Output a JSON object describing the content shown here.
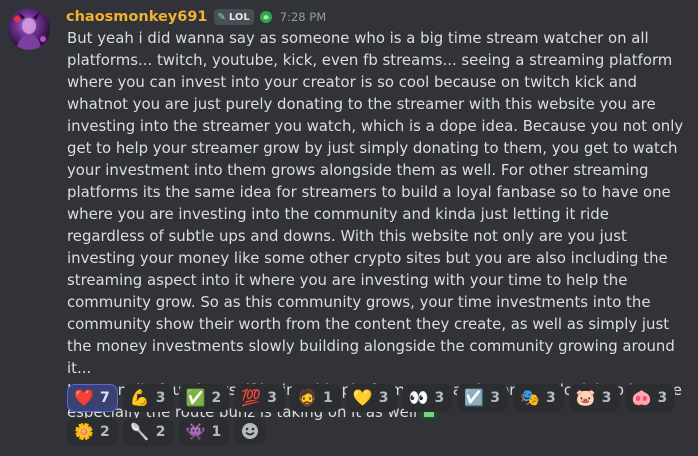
{
  "message": {
    "username": "chaosmonkey691",
    "tag": "LOL",
    "timestamp": "7:28 PM",
    "paragraphs": [
      "But yeah i did wanna say as someone who is a big time stream watcher on all platforms... twitch, youtube, kick, even fb streams... seeing a streaming platform where you can invest into your creator is so cool because on twitch kick and whatnot you are just purely donating to the streamer with this website you are investing into the streamer you watch, which is a dope idea. Because you not only get to help your streamer grow by just simply donating to them, you get to watch your investment into them grows alongside them as well. For other streaming platforms its the same idea for streamers to build a loyal fanbase so to have one where you are investing into the community and kinda just letting it ride regardless of subtle ups and downs. With this website not only are you just investing your money like some other crypto sites but you are also including the streaming aspect into it where you are investing with your time to help the community grow. So as this community grows, your time investments into the community show their worth from the content they create, as well as simply just the money investments slowly building alongside the community growing around it...",
      "I personally found myself loving this platform more and more as I look into it more especially the route bunz is taking on it as well"
    ]
  },
  "reactions": [
    {
      "name": "heart",
      "glyph": "❤️",
      "count": "7",
      "active": true
    },
    {
      "name": "flexed-biceps",
      "glyph": "💪",
      "count": "3"
    },
    {
      "name": "check-mark-button",
      "glyph": "✅",
      "count": "2"
    },
    {
      "name": "hundred-points",
      "glyph": "💯",
      "count": "3"
    },
    {
      "name": "custom-face",
      "glyph": "🧔",
      "count": "1"
    },
    {
      "name": "yellow-heart",
      "glyph": "💛",
      "count": "3"
    },
    {
      "name": "eyes",
      "glyph": "👀",
      "count": "3"
    },
    {
      "name": "check-box",
      "glyph": "☑️",
      "count": "3"
    },
    {
      "name": "custom-gif-1",
      "glyph": "🎭",
      "count": "3"
    },
    {
      "name": "custom-pig",
      "glyph": "🐷",
      "count": "3"
    },
    {
      "name": "pig-face",
      "glyph": "🐽",
      "count": "3"
    },
    {
      "name": "custom-plant",
      "glyph": "🌼",
      "count": "2"
    },
    {
      "name": "custom-small",
      "glyph": "🥄",
      "count": "2"
    },
    {
      "name": "custom-glitch",
      "glyph": "👾",
      "count": "1"
    }
  ]
}
